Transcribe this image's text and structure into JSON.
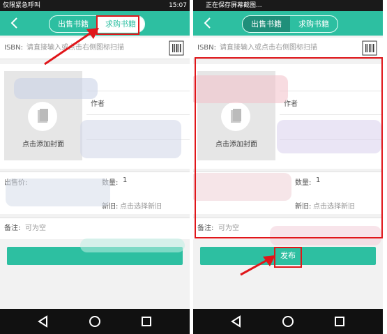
{
  "left": {
    "status_left": "仅限紧急呼叫",
    "status_right": "15:07",
    "tab_sell": "出售书籍",
    "tab_buy": "求购书籍",
    "isbn_label": "ISBN:",
    "isbn_placeholder": "请直接输入或点击右侧图标扫描",
    "add_cover": "点击添加封面",
    "author_label": "作者",
    "price_label": "出售价:",
    "qty_label": "数量:",
    "qty_value": "1",
    "condition_label": "新旧:",
    "condition_placeholder": "点击选择新旧",
    "note_label": "备注:",
    "note_placeholder": "可为空"
  },
  "right": {
    "status_text": "正在保存屏幕截图...",
    "tab_sell": "出售书籍",
    "tab_buy": "求购书籍",
    "isbn_label": "ISBN:",
    "isbn_placeholder": "请直接输入或点击右侧图标扫描",
    "add_cover": "点击添加封面",
    "author_label": "作者",
    "qty_label": "数量:",
    "qty_value": "1",
    "condition_label": "新旧:",
    "condition_placeholder": "点击选择新旧",
    "note_label": "备注:",
    "note_placeholder": "可为空",
    "publish": "发布"
  },
  "colors": {
    "accent": "#2dbfa1",
    "highlight": "#e0161a"
  }
}
